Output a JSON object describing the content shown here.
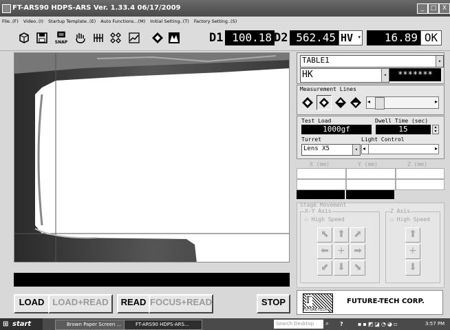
{
  "window": {
    "title": "FT-ARS90  HDPS-ARS Ver. 1.33.4  06/17/2009",
    "controls": [
      "_",
      "□",
      "X"
    ]
  },
  "menu": [
    "File..(F)",
    "Video..(I)",
    "Startup Template..(E)",
    "Auto Functions...(M)",
    "Initial Setting..(T)",
    "Factory Setting..(S)"
  ],
  "toolbar": {
    "snap_label": "SNAP",
    "d1_label": "D1",
    "d1_value": "100.18",
    "d2_label": "D2",
    "d2_value": "562.45",
    "scale_select": "HV",
    "hardness_value": "16.89",
    "ok_label": "OK"
  },
  "right_panel": {
    "table_select": "TABLE1",
    "scale_select": "HK",
    "result_value": "*******",
    "measurement_lines_title": "Measurement Lines",
    "test_load_label": "Test Load",
    "test_load_value": "1000gf",
    "dwell_time_label": "Dwell Time (sec)",
    "dwell_time_value": "15",
    "turret_label": "Turret",
    "turret_value": "Lens X5",
    "light_control_label": "Light Control",
    "x_label": "X (mm)",
    "y_label": "Y (mm)",
    "z_label": "Z (mm)",
    "stage_movement_title": "Stage Movement",
    "xy_axis_title": "X-Y Axis",
    "z_axis_title": "Z Axis",
    "xy_high_speed": "High Speed",
    "z_high_speed": "High Speed"
  },
  "bottom_buttons": {
    "load": "LOAD",
    "load_read": "LOAD+READ",
    "read": "READ",
    "focus_read": "FOCUS+READ",
    "stop": "STOP"
  },
  "logo": {
    "company": "FUTURE-TECH CORP.",
    "small": "FUTURE-TECH"
  },
  "taskbar": {
    "start": "start",
    "item1": "Brown Paper Screen ...",
    "item2": "FT-ARS90 HDPS-ARS...",
    "search": "Search Desktop",
    "time": "3:57 PM"
  }
}
